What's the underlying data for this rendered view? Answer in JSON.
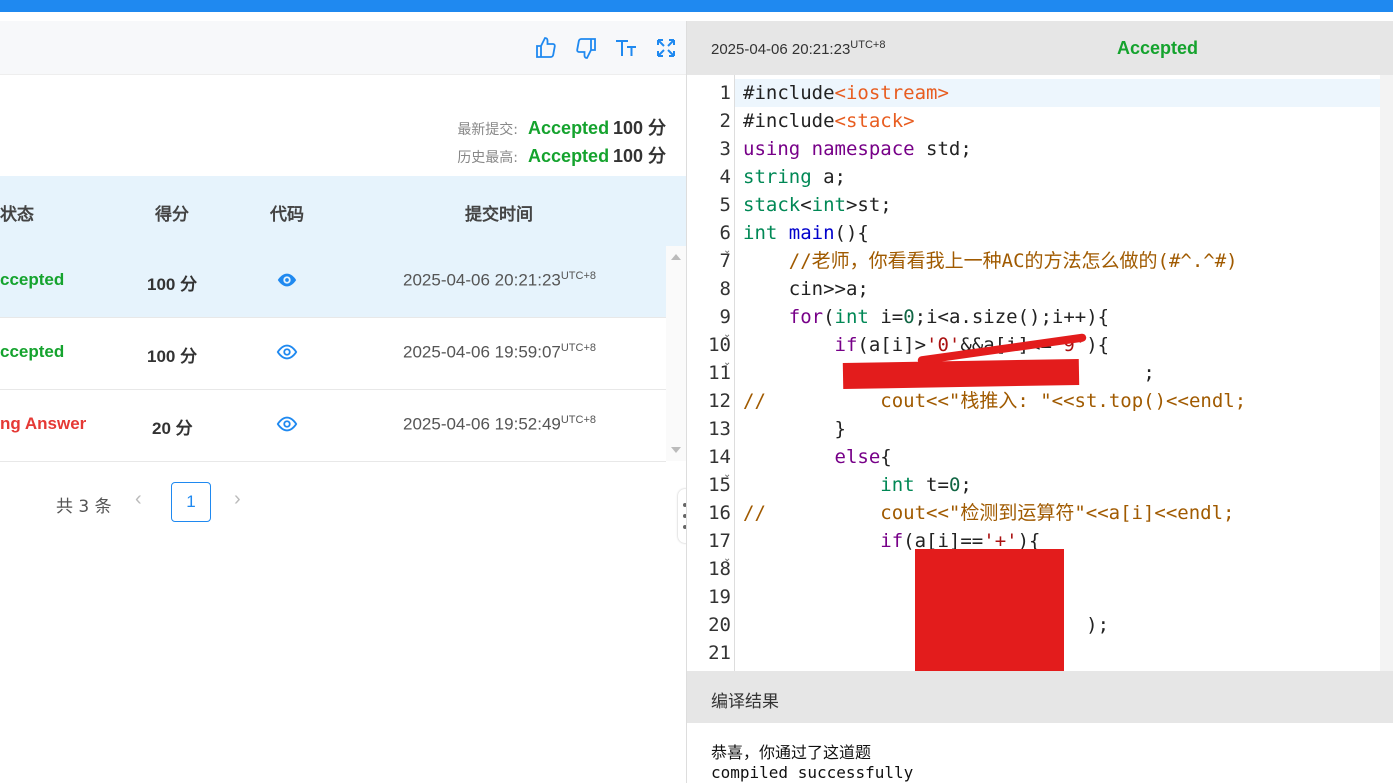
{
  "toolbar": {
    "icons": [
      "thumbs-up-icon",
      "thumbs-down-icon",
      "font-size-icon",
      "fullscreen-icon"
    ]
  },
  "summary": {
    "latest_label": "最新提交:",
    "latest_status": "Accepted",
    "latest_score": "100 分",
    "best_label": "历史最高:",
    "best_status": "Accepted",
    "best_score": "100 分"
  },
  "table": {
    "headers": {
      "status": "状态",
      "score": "得分",
      "code": "代码",
      "time": "提交时间"
    },
    "rows": [
      {
        "status": "ccepted",
        "score": "100 分",
        "time": "2025-04-06 20:21:23",
        "tz": "UTC+8"
      },
      {
        "status": "ccepted",
        "score": "100 分",
        "time": "2025-04-06 19:59:07",
        "tz": "UTC+8"
      },
      {
        "status": "ng Answer",
        "score": "20 分",
        "time": "2025-04-06 19:52:49",
        "tz": "UTC+8"
      }
    ]
  },
  "pager": {
    "total": "共 3 条",
    "prev": "‹",
    "current": "1",
    "next": "›"
  },
  "detail": {
    "time": "2025-04-06 20:21:23",
    "tz": "UTC+8",
    "verdict": "Accepted"
  },
  "code_lines": {
    "l1": "#include",
    "l1b": "<iostream>",
    "l2": "#include",
    "l2b": "<stack>",
    "l3a": "using",
    "l3b": "namespace",
    "l3c": " std;",
    "l4a": "string",
    "l4b": " a;",
    "l5a": "stack",
    "l5b": "<",
    "l5c": "int",
    "l5d": ">st;",
    "l6a": "int",
    "l6b": "main",
    "l6c": "(){",
    "l7": "    //老师，你看看我上一种AC的方法怎么做的(#^.^#)",
    "l8": "    cin>>a;",
    "l9a": "    ",
    "l9b": "for",
    "l9c": "(",
    "l9d": "int",
    "l9e": " i=",
    "l9f": "0",
    "l9g": ";i<a.size();i++){",
    "l10a": "        ",
    "l10b": "if",
    "l10c": "(a[i]>",
    "l10d": "'0'",
    "l10e": "&&a[i]<=",
    "l10f": "'9'",
    "l10g": "){",
    "l11": "                                   ;",
    "l12a": "//",
    "l12b": "          cout<<\"栈推入: \"<<st.top()<<endl;",
    "l13": "        }",
    "l14a": "        ",
    "l14b": "else",
    "l14c": "{",
    "l15a": "            ",
    "l15b": "int",
    "l15c": " t=",
    "l15d": "0",
    "l15e": ";",
    "l16a": "//",
    "l16b": "          cout<<\"检测到运算符\"<<a[i]<<endl;",
    "l17a": "            ",
    "l17b": "if",
    "l17c": "(a[i]==",
    "l17d": "'+'",
    "l17e": "){",
    "l20": "                              );"
  },
  "compile": {
    "title": "编译结果",
    "line1": "恭喜，你通过了这道题",
    "line2": "compiled successfully"
  },
  "colors": {
    "accent": "#1f89f0",
    "accepted": "#15a32e",
    "wrong": "#e53935",
    "redaction": "#e31c1c"
  }
}
